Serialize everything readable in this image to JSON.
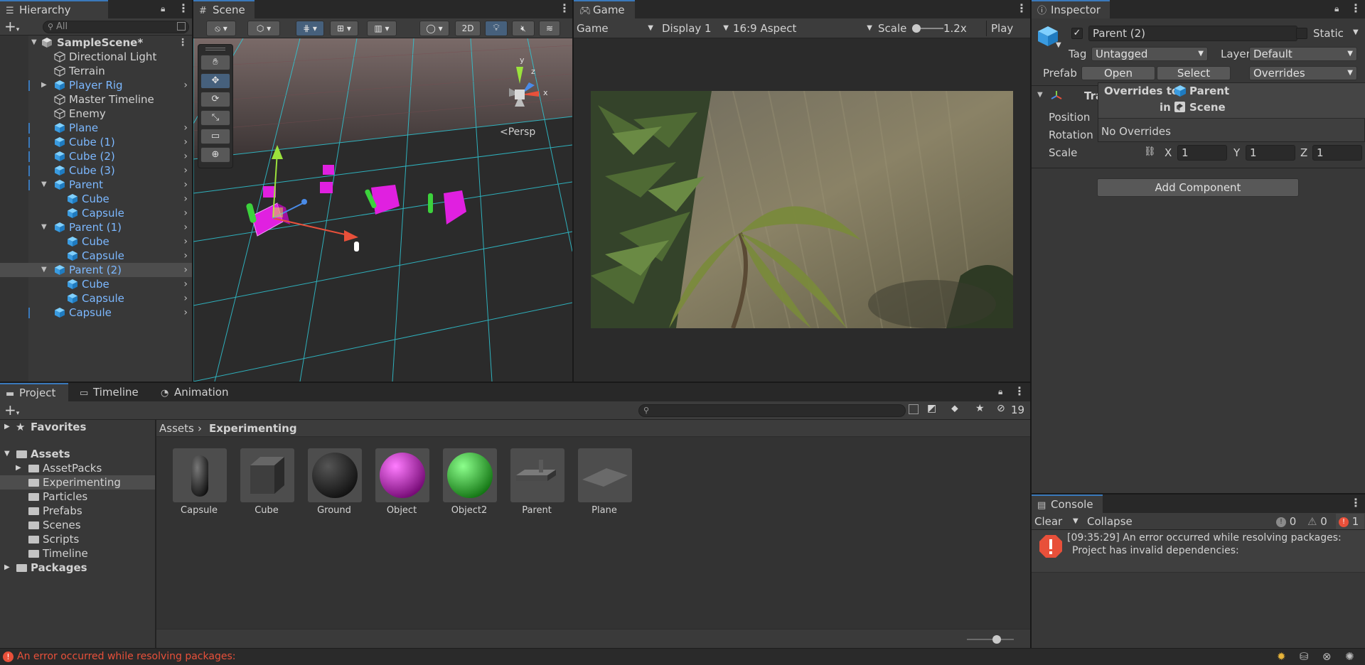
{
  "hierarchy": {
    "tab": "Hierarchy",
    "search_placeholder": "All",
    "scene_name": "SampleScene*",
    "items": [
      {
        "label": "Directional Light"
      },
      {
        "label": "Terrain"
      },
      {
        "label": "Player Rig"
      },
      {
        "label": "Master Timeline"
      },
      {
        "label": "Enemy"
      },
      {
        "label": "Plane"
      },
      {
        "label": "Cube (1)"
      },
      {
        "label": "Cube (2)"
      },
      {
        "label": "Cube (3)"
      },
      {
        "label": "Parent"
      },
      {
        "label": "Cube"
      },
      {
        "label": "Capsule"
      },
      {
        "label": "Parent (1)"
      },
      {
        "label": "Cube"
      },
      {
        "label": "Capsule"
      },
      {
        "label": "Parent (2)"
      },
      {
        "label": "Cube"
      },
      {
        "label": "Capsule"
      },
      {
        "label": "Capsule"
      }
    ]
  },
  "scene": {
    "tab": "Scene",
    "btn_2d": "2D",
    "persp_label": "<Persp",
    "gizmo_y": "y",
    "gizmo_z": "z",
    "gizmo_x": "x"
  },
  "game": {
    "tab": "Game",
    "display_mode": "Game",
    "display": "Display 1",
    "aspect": "16:9 Aspect",
    "scale_label": "Scale",
    "scale_value": "1.2x",
    "play_focused": "Play Foc"
  },
  "inspector": {
    "tab": "Inspector",
    "object_name": "Parent (2)",
    "static_label": "Static",
    "tag_label": "Tag",
    "tag_value": "Untagged",
    "layer_label": "Layer",
    "layer_value": "Default",
    "prefab_label": "Prefab",
    "open_btn": "Open",
    "select_btn": "Select",
    "overrides_btn": "Overrides",
    "transform_label": "Tra",
    "position_label": "Position",
    "rotation_label": "Rotation",
    "scale_label": "Scale",
    "scale_x_label": "X",
    "scale_x": "1",
    "scale_y_label": "Y",
    "scale_y": "1",
    "scale_z_label": "Z",
    "scale_z": "1",
    "add_component": "Add Component",
    "overrides_popup": {
      "line1_prefix": "Overrides to",
      "line1_target": "Parent",
      "line2_prefix": "in",
      "line2_target": "Scene",
      "status": "No Overrides"
    }
  },
  "project": {
    "tabs": [
      "Project",
      "Timeline",
      "Animation"
    ],
    "hidden_count": "19",
    "tree": {
      "favorites": "Favorites",
      "assets": "Assets",
      "folders": [
        "AssetPacks",
        "Experimenting",
        "Particles",
        "Prefabs",
        "Scenes",
        "Scripts",
        "Timeline"
      ],
      "packages": "Packages"
    },
    "breadcrumb": {
      "root": "Assets",
      "current": "Experimenting"
    },
    "assets": [
      {
        "label": "Capsule"
      },
      {
        "label": "Cube"
      },
      {
        "label": "Ground"
      },
      {
        "label": "Object"
      },
      {
        "label": "Object2"
      },
      {
        "label": "Parent"
      },
      {
        "label": "Plane"
      }
    ]
  },
  "console": {
    "tab": "Console",
    "clear": "Clear",
    "collapse": "Collapse",
    "info_count": "0",
    "warn_count": "0",
    "error_count": "1",
    "message_line1": "[09:35:29] An error occurred while resolving packages:",
    "message_line2": "Project has invalid dependencies:"
  },
  "statusbar": {
    "message": "An error occurred while resolving packages:"
  },
  "colors": {
    "accent_blue": "#3a79bb",
    "prefab_blue": "#7cb8ff",
    "error_red": "#e8503a",
    "scene_grid": "#2fc8d6",
    "magenta": "#e020e0"
  }
}
